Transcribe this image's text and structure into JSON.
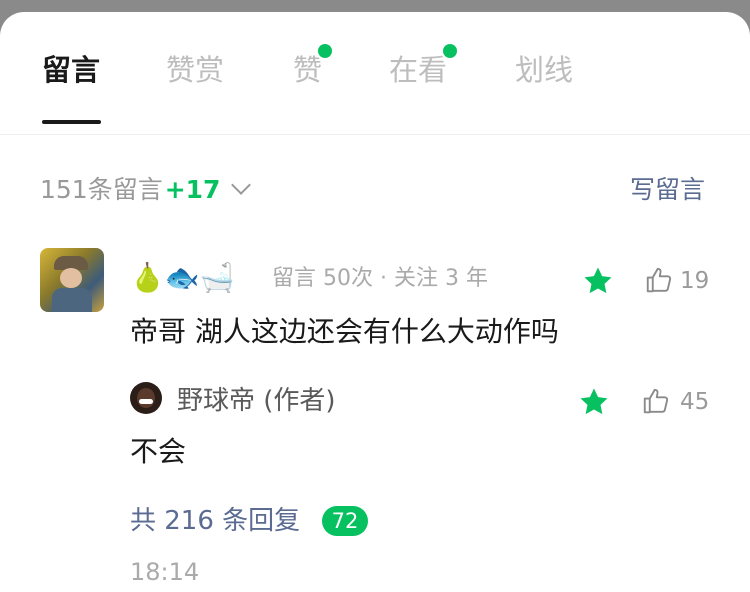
{
  "tabs": {
    "messages": "留言",
    "rewards": "赞赏",
    "likes": "赞",
    "watching": "在看",
    "highlights": "划线"
  },
  "header": {
    "count_label": "151条留言",
    "new_count": "+17",
    "write_label": "写留言"
  },
  "comment": {
    "emojis": "🍐🐟🛁",
    "meta": "留言 50次 · 关注 3 年",
    "like_count": "19",
    "text": "帝哥 湖人这边还会有什么大动作吗"
  },
  "reply": {
    "name": "野球帝 (作者)",
    "like_count": "45",
    "text": "不会"
  },
  "thread": {
    "replies_label": "共 216 条回复",
    "new_replies": "72",
    "time": "18:14"
  },
  "colors": {
    "accent": "#07c160",
    "link": "#5b6b92"
  }
}
